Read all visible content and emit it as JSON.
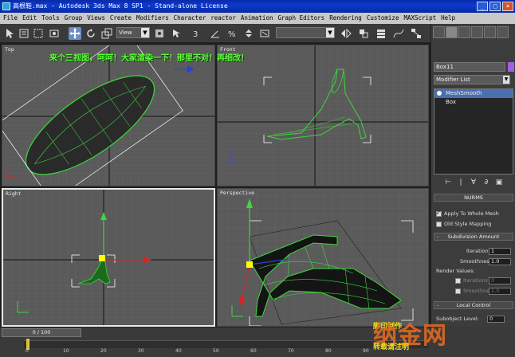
{
  "window": {
    "title": "高根鞋.max - Autodesk 3ds Max 8 SP1 - Stand-alone License",
    "minimize": "_",
    "maximize": "□",
    "close": "×"
  },
  "menu": [
    "File",
    "Edit",
    "Tools",
    "Group",
    "Views",
    "Create",
    "Modifiers",
    "Character",
    "reactor",
    "Animation",
    "Graph Editors",
    "Rendering",
    "Customize",
    "MAXScript",
    "Help"
  ],
  "toolbar": {
    "ref_coord": "View",
    "ref_coord2": "View",
    "named_selection": ""
  },
  "viewports": {
    "top": "Top",
    "front": "Front",
    "right": "Right",
    "perspective": "Perspective",
    "overlay_text": "来个三视图，呵呵！大家渲染一下！那里不对！再细改！"
  },
  "command_panel": {
    "object_name": "Box11",
    "object_color": "#a060e0",
    "modifier_list": "Modifier List",
    "stack": [
      "MeshSmooth",
      "Box"
    ],
    "rollout_partial": "NURMS",
    "apply_whole_mesh": "Apply To Whole Mesh",
    "old_style_mapping": "Old Style Mapping",
    "subdivision_title": "Subdivision Amount",
    "iterations_label": "Iterations:",
    "iterations_value": "1",
    "smoothness_label": "Smoothness:",
    "smoothness_value": "1.0",
    "render_values": "Render Values:",
    "render_iterations_label": "Iterations",
    "render_iterations_value": "0",
    "render_smoothness_label": "Smoothness",
    "render_smoothness_value": "1.0",
    "local_control_title": "Local Control",
    "subobject_level": "Subobject Level:",
    "subobject_value": "0"
  },
  "timeline": {
    "slider_label": "0 / 100",
    "ticks": [
      "0",
      "10",
      "20",
      "30",
      "40",
      "50",
      "60",
      "70",
      "80",
      "90"
    ]
  },
  "watermark": {
    "brand": "纳金网",
    "line1": "脚印制作",
    "line2": "转载请注明"
  }
}
